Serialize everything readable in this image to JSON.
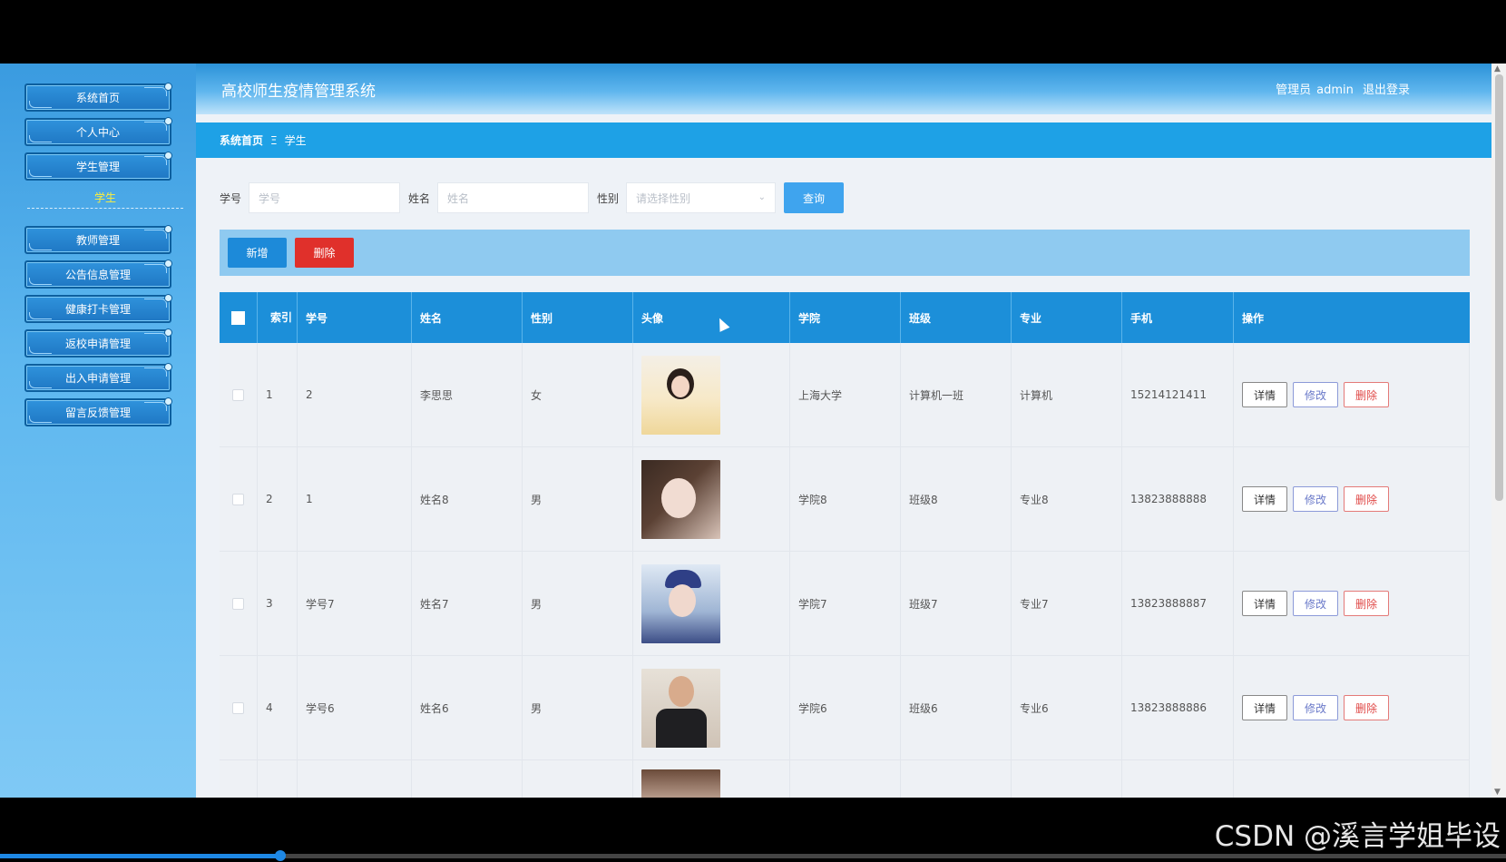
{
  "app": {
    "title": "高校师生疫情管理系统",
    "user_role": "管理员",
    "user_name": "admin",
    "logout": "退出登录"
  },
  "sidebar": {
    "items": [
      {
        "label": "系统首页"
      },
      {
        "label": "个人中心"
      },
      {
        "label": "学生管理"
      },
      {
        "label": "教师管理"
      },
      {
        "label": "公告信息管理"
      },
      {
        "label": "健康打卡管理"
      },
      {
        "label": "返校申请管理"
      },
      {
        "label": "出入申请管理"
      },
      {
        "label": "留言反馈管理"
      }
    ],
    "active_sub": "学生"
  },
  "breadcrumb": {
    "home": "系统首页",
    "separator": "Ξ",
    "current": "学生"
  },
  "search": {
    "id_label": "学号",
    "id_placeholder": "学号",
    "name_label": "姓名",
    "name_placeholder": "姓名",
    "gender_label": "性别",
    "gender_placeholder": "请选择性别",
    "query_button": "查询"
  },
  "toolbar": {
    "add": "新增",
    "delete": "删除"
  },
  "table": {
    "headers": {
      "index": "索引",
      "student_id": "学号",
      "name": "姓名",
      "gender": "性别",
      "avatar": "头像",
      "college": "学院",
      "class": "班级",
      "major": "专业",
      "phone": "手机",
      "ops": "操作"
    },
    "ops": {
      "detail": "详情",
      "edit": "修改",
      "delete": "删除"
    },
    "rows": [
      {
        "index": "1",
        "student_id": "2",
        "name": "李思思",
        "gender": "女",
        "college": "上海大学",
        "class": "计算机一班",
        "major": "计算机",
        "phone": "15214121411"
      },
      {
        "index": "2",
        "student_id": "1",
        "name": "姓名8",
        "gender": "男",
        "college": "学院8",
        "class": "班级8",
        "major": "专业8",
        "phone": "13823888888"
      },
      {
        "index": "3",
        "student_id": "学号7",
        "name": "姓名7",
        "gender": "男",
        "college": "学院7",
        "class": "班级7",
        "major": "专业7",
        "phone": "13823888887"
      },
      {
        "index": "4",
        "student_id": "学号6",
        "name": "姓名6",
        "gender": "男",
        "college": "学院6",
        "class": "班级6",
        "major": "专业6",
        "phone": "13823888886"
      }
    ]
  },
  "watermark": "CSDN @溪言学姐毕设"
}
